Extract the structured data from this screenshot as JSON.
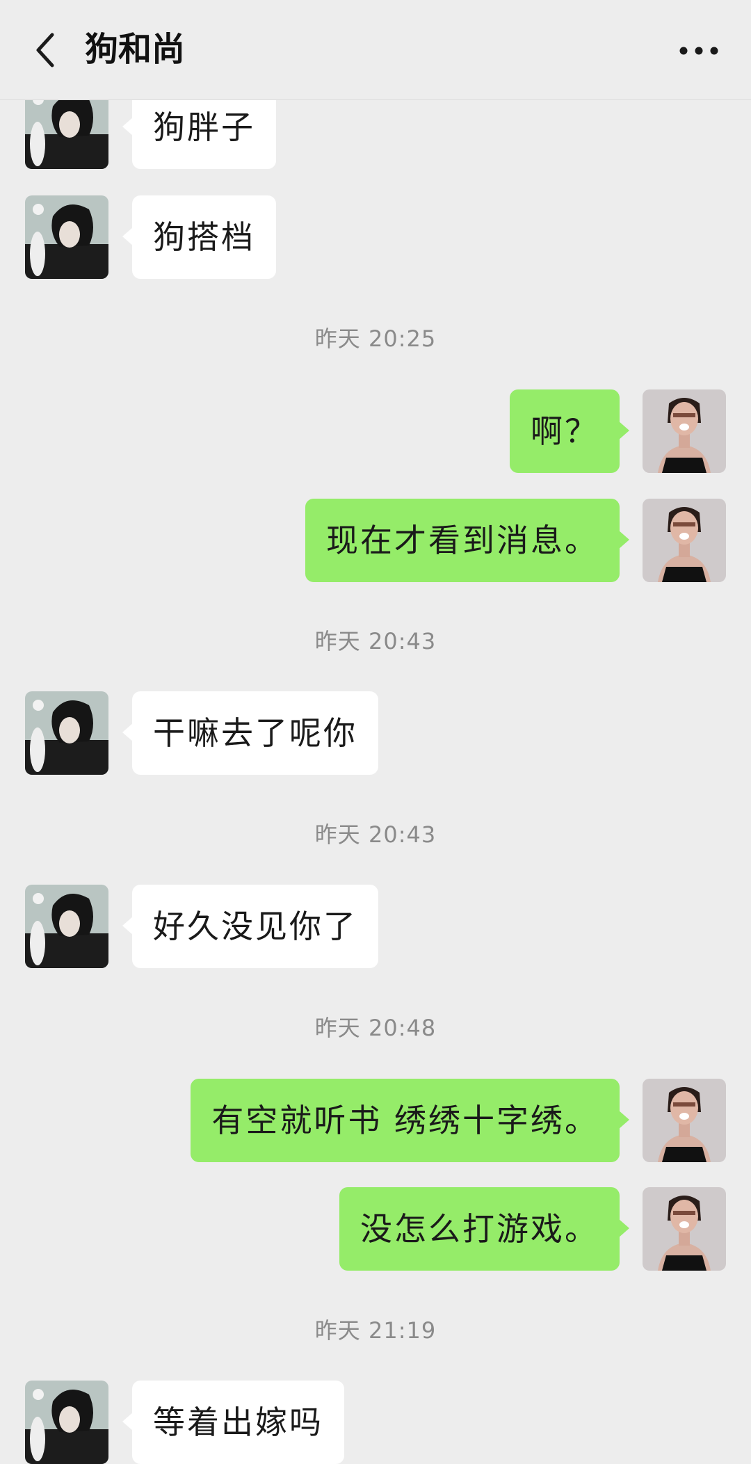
{
  "header": {
    "title": "狗和尚",
    "back_icon": "chevron-left-icon",
    "more_icon": "ellipsis-icon"
  },
  "colors": {
    "background": "#ededed",
    "sent_bubble": "#95ec69",
    "received_bubble": "#ffffff",
    "timestamp": "#8a8a8a"
  },
  "messages": [
    {
      "type": "received",
      "text": "狗胖子"
    },
    {
      "type": "received",
      "text": "狗搭档"
    },
    {
      "type": "time",
      "text": "昨天 20:25"
    },
    {
      "type": "sent",
      "text": "啊？"
    },
    {
      "type": "sent",
      "text": "现在才看到消息。"
    },
    {
      "type": "time",
      "text": "昨天 20:43"
    },
    {
      "type": "received",
      "text": "干嘛去了呢你"
    },
    {
      "type": "time",
      "text": "昨天 20:43"
    },
    {
      "type": "received",
      "text": "好久没见你了"
    },
    {
      "type": "time",
      "text": "昨天 20:48"
    },
    {
      "type": "sent",
      "text": "有空就听书 绣绣十字绣。"
    },
    {
      "type": "sent",
      "text": "没怎么打游戏。"
    },
    {
      "type": "time",
      "text": "昨天 21:19"
    },
    {
      "type": "received",
      "text": "等着出嫁吗"
    }
  ]
}
